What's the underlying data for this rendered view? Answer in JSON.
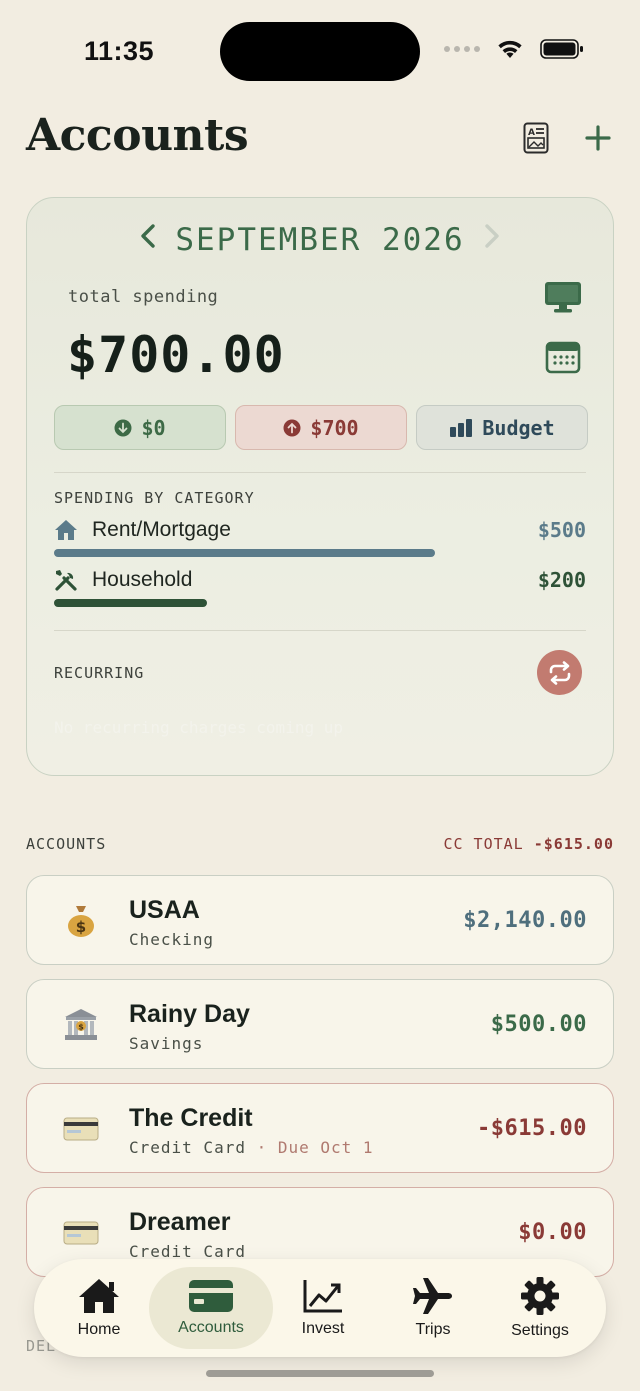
{
  "status_bar": {
    "time": "11:35"
  },
  "header": {
    "title": "Accounts",
    "icons": [
      "report-icon",
      "plus-icon"
    ]
  },
  "summary": {
    "month": "SEPTEMBER 2026",
    "total_label": "total spending",
    "total_amount": "$700.00",
    "income_pill": "$0",
    "expense_pill": "$700",
    "budget_pill": "Budget",
    "spending_by_category_label": "SPENDING BY CATEGORY",
    "categories": [
      {
        "name": "Rent/Mortgage",
        "amount": "$500",
        "icon": "house-icon",
        "color": "#5b7b8a",
        "fraction": 0.714
      },
      {
        "name": "Household",
        "amount": "$200",
        "icon": "tools-icon",
        "color": "#2e5237",
        "fraction": 0.286
      }
    ],
    "recurring_label": "RECURRING",
    "recurring_empty": "No recurring charges coming up"
  },
  "accounts_section": {
    "label": "ACCOUNTS",
    "cc_total_label": "CC TOTAL",
    "cc_total_value": "-$615.00",
    "items": [
      {
        "name": "USAA",
        "type": "Checking",
        "due": "",
        "balance": "$2,140.00",
        "icon": "money-bag-icon",
        "balance_color": "#4f6f7d"
      },
      {
        "name": "Rainy Day",
        "type": "Savings",
        "due": "",
        "balance": "$500.00",
        "icon": "bank-icon",
        "balance_color": "#3b6a49"
      },
      {
        "name": "The Credit",
        "type": "Credit Card",
        "due": " · Due Oct 1",
        "balance": "-$615.00",
        "icon": "credit-card-icon",
        "balance_color": "#8a3a36"
      },
      {
        "name": "Dreamer",
        "type": "Credit Card",
        "due": "",
        "balance": "$0.00",
        "icon": "credit-card-icon",
        "balance_color": "#8a3a36"
      }
    ]
  },
  "deleted_label": "DEL",
  "tabbar": {
    "tabs": [
      {
        "label": "Home",
        "icon": "home-icon"
      },
      {
        "label": "Accounts",
        "icon": "wallet-icon",
        "active": true
      },
      {
        "label": "Invest",
        "icon": "chart-line-icon"
      },
      {
        "label": "Trips",
        "icon": "airplane-icon"
      },
      {
        "label": "Settings",
        "icon": "gear-icon"
      }
    ]
  },
  "colors": {
    "background": "#f2ede1",
    "accent_green": "#3b6a49",
    "expense_red": "#8a3a36",
    "recurring_button": "#c27b70"
  }
}
